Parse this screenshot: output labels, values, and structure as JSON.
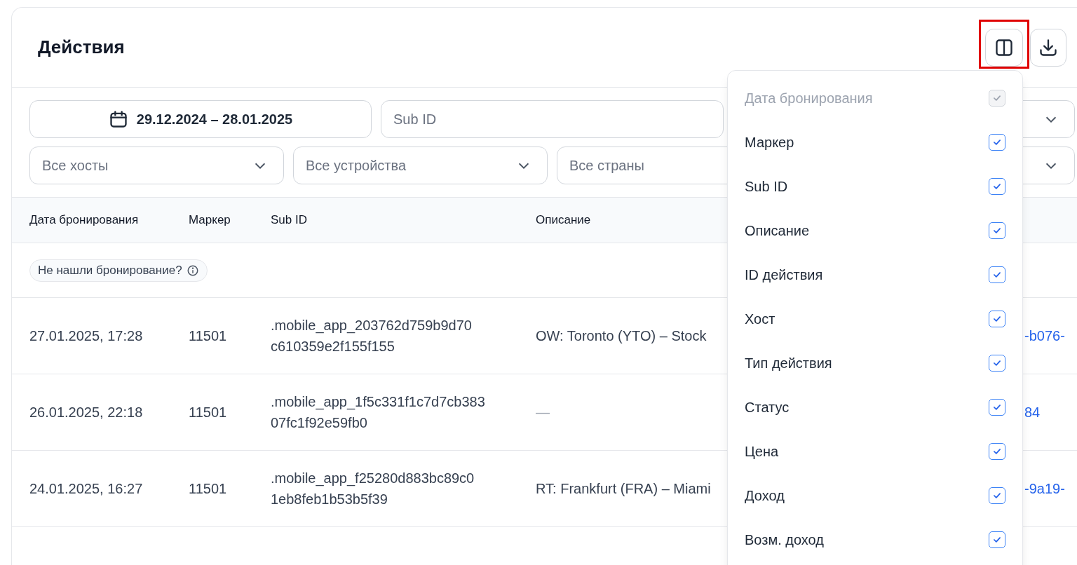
{
  "page": {
    "title": "Действия"
  },
  "filters": {
    "date_range": "29.12.2024 – 28.01.2025",
    "sub_id": {
      "placeholder": "Sub ID"
    },
    "selects": [
      {
        "placeholder": "Все хосты"
      },
      {
        "placeholder": "Все устройства"
      },
      {
        "placeholder": "Все страны"
      }
    ]
  },
  "table": {
    "columns": [
      "Дата бронирования",
      "Маркер",
      "Sub ID",
      "Описание"
    ],
    "notice": "Не нашли бронирование?",
    "rows": [
      {
        "date": "27.01.2025, 17:28",
        "marker": "11501",
        "sub_id_lines": [
          ".mobile_app_203762d759b9d70",
          "c610359e2f155f155"
        ],
        "description": "OW: Toronto (YTO) – Stock",
        "description_muted": false,
        "column_5": "-b076-"
      },
      {
        "date": "26.01.2025, 22:18",
        "marker": "11501",
        "sub_id_lines": [
          ".mobile_app_1f5c331f1c7d7cb383",
          "07fc1f92e59fb0"
        ],
        "description": "—",
        "description_muted": true,
        "column_5": "84"
      },
      {
        "date": "24.01.2025, 16:27",
        "marker": "11501",
        "sub_id_lines": [
          ".mobile_app_f25280d883bc89c0",
          "1eb8feb1b53b5f39"
        ],
        "description": "RT: Frankfurt (FRA) – Miami",
        "description_muted": false,
        "column_5": "-9a19-"
      }
    ]
  },
  "column_menu": {
    "items": [
      {
        "label": "Дата бронирования",
        "checked": true,
        "disabled": true
      },
      {
        "label": "Маркер",
        "checked": true,
        "disabled": false
      },
      {
        "label": "Sub ID",
        "checked": true,
        "disabled": false
      },
      {
        "label": "Описание",
        "checked": true,
        "disabled": false
      },
      {
        "label": "ID действия",
        "checked": true,
        "disabled": false
      },
      {
        "label": "Хост",
        "checked": true,
        "disabled": false
      },
      {
        "label": "Тип действия",
        "checked": true,
        "disabled": false
      },
      {
        "label": "Статус",
        "checked": true,
        "disabled": false
      },
      {
        "label": "Цена",
        "checked": true,
        "disabled": false
      },
      {
        "label": "Доход",
        "checked": true,
        "disabled": false
      },
      {
        "label": "Возм. доход",
        "checked": true,
        "disabled": false
      }
    ]
  }
}
